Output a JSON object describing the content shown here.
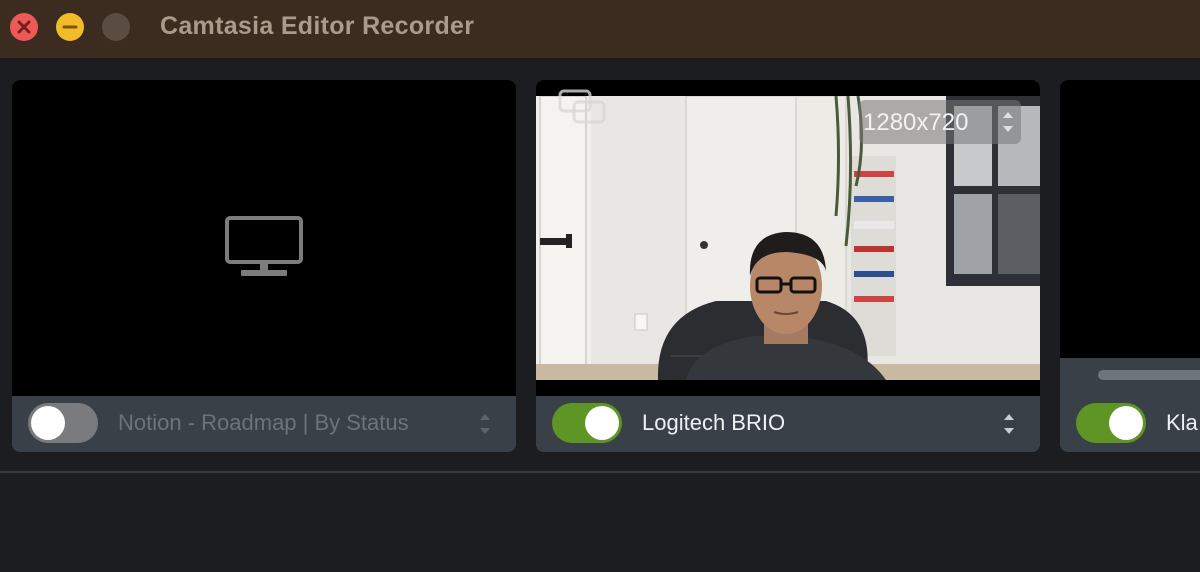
{
  "window": {
    "title": "Camtasia Editor Recorder",
    "controls": [
      "close",
      "minimize",
      "maximize"
    ]
  },
  "sources": [
    {
      "type": "screen",
      "label": "Notion - Roadmap | By Status",
      "enabled": false,
      "icon": "monitor-icon"
    },
    {
      "type": "camera",
      "label": "Logitech BRIO",
      "enabled": true,
      "resolution": "1280x720",
      "icon": "multi-window-icon"
    },
    {
      "type": "microphone",
      "label": "Kla",
      "enabled": true
    }
  ],
  "colors": {
    "toggle_on": "#5e9524",
    "toggle_off": "#797b7e",
    "card_bg": "#3a4048",
    "titlebar_bg": "#3b2c1f"
  }
}
